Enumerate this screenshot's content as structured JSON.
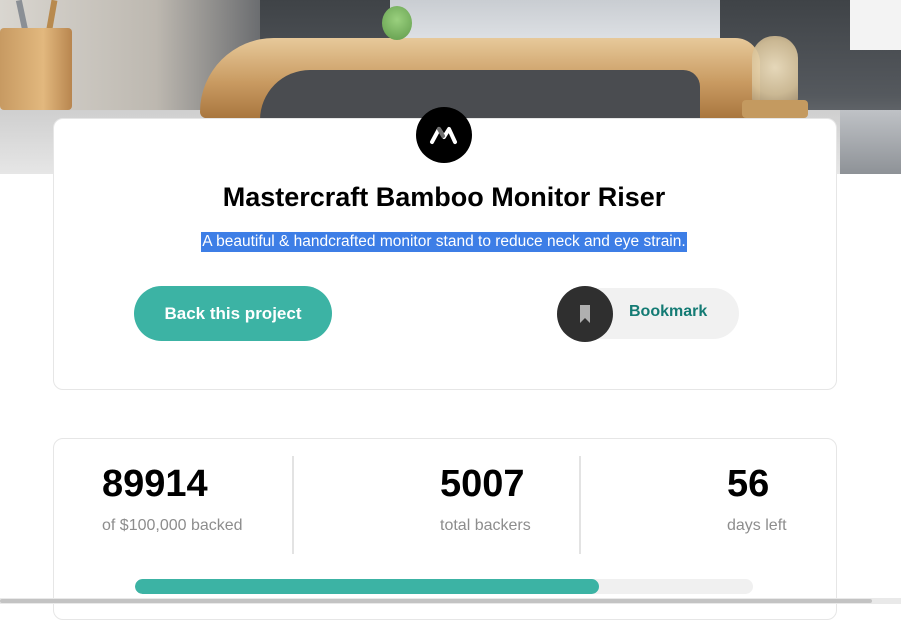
{
  "project": {
    "title": "Mastercraft Bamboo Monitor Riser",
    "description": "A beautiful & handcrafted monitor stand to reduce neck and eye strain.",
    "back_button_label": "Back this project",
    "bookmark_label": "Bookmark",
    "logo_icon": "mastercraft-logo-icon",
    "bookmark_icon": "bookmark-icon"
  },
  "stats": {
    "backed_amount": "89914",
    "backed_label": "of $100,000 backed",
    "total_backers": "5007",
    "backers_label": "total backers",
    "days_left": "56",
    "days_label": "days left",
    "progress_fraction": 0.75
  },
  "colors": {
    "accent": "#3cb3a4",
    "accent_dark": "#147b74",
    "selection": "#3d7ee6"
  }
}
